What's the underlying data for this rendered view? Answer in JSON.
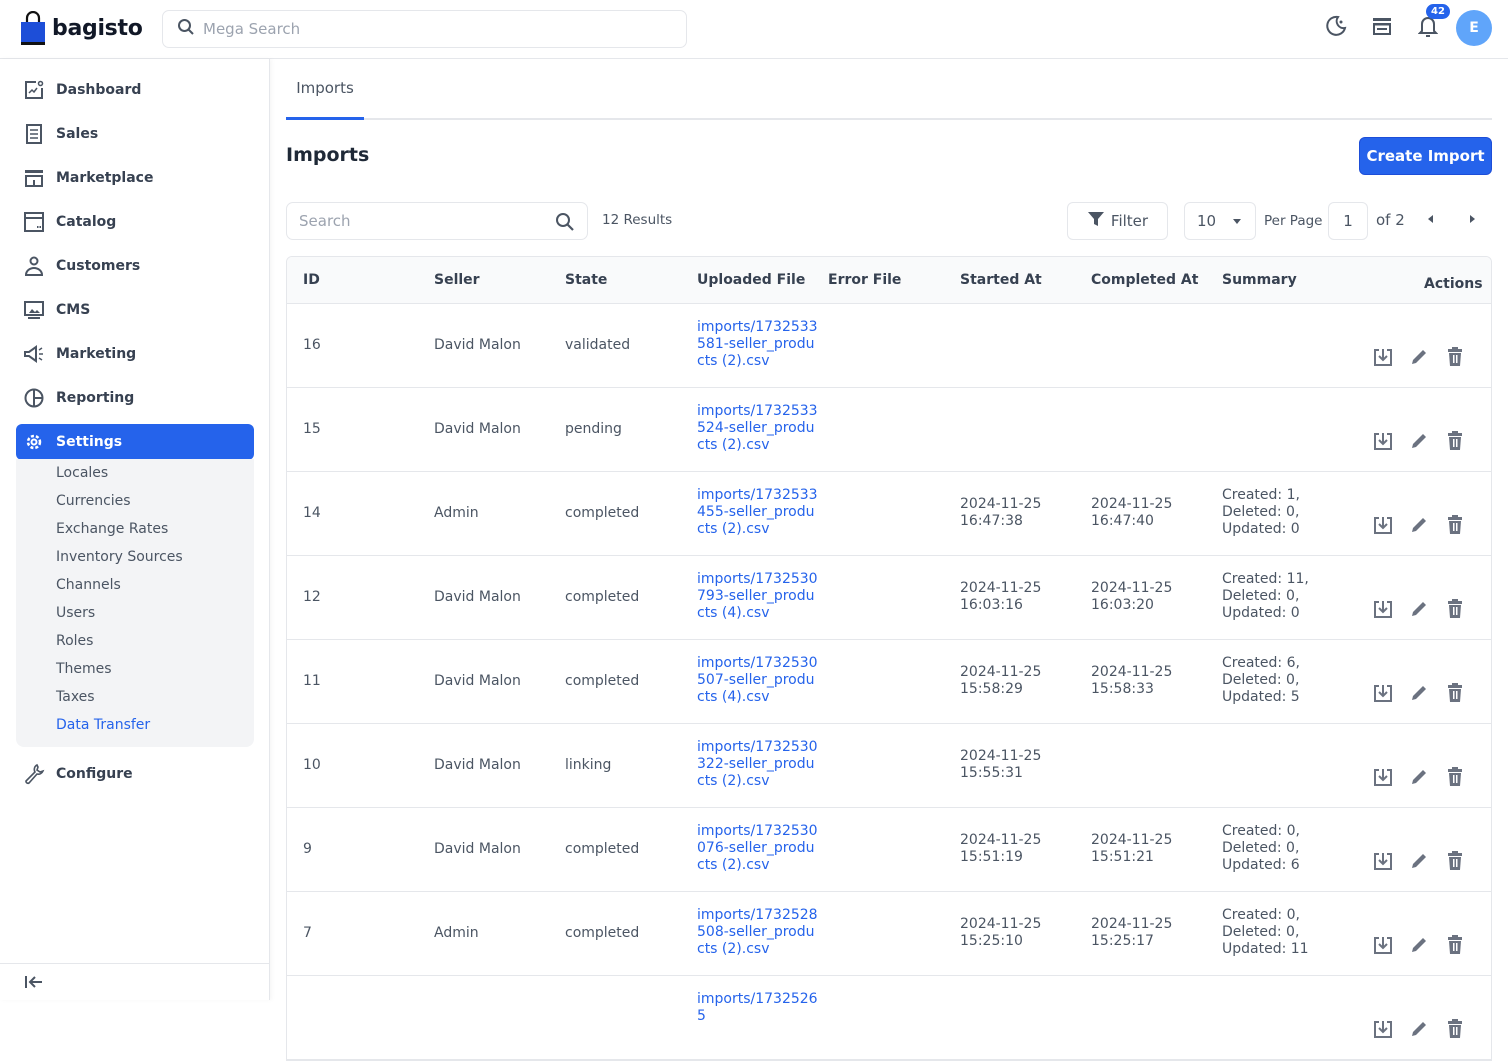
{
  "header": {
    "brand": "bagisto",
    "search_placeholder": "Mega Search",
    "notification_count": "42",
    "avatar_initial": "E",
    "icons": [
      "moon-icon",
      "store-icon",
      "bell-icon"
    ]
  },
  "sidebar": {
    "items": [
      {
        "label": "Dashboard",
        "icon": "dashboard-icon"
      },
      {
        "label": "Sales",
        "icon": "sales-icon"
      },
      {
        "label": "Marketplace",
        "icon": "marketplace-icon"
      },
      {
        "label": "Catalog",
        "icon": "catalog-icon"
      },
      {
        "label": "Customers",
        "icon": "customers-icon"
      },
      {
        "label": "CMS",
        "icon": "cms-icon"
      },
      {
        "label": "Marketing",
        "icon": "megaphone-icon"
      },
      {
        "label": "Reporting",
        "icon": "reporting-icon"
      },
      {
        "label": "Settings",
        "icon": "gear-icon",
        "active": true
      },
      {
        "label": "Configure",
        "icon": "wrench-icon"
      }
    ],
    "settings_children": [
      {
        "label": "Locales"
      },
      {
        "label": "Currencies"
      },
      {
        "label": "Exchange Rates"
      },
      {
        "label": "Inventory Sources"
      },
      {
        "label": "Channels"
      },
      {
        "label": "Users"
      },
      {
        "label": "Roles"
      },
      {
        "label": "Themes"
      },
      {
        "label": "Taxes"
      },
      {
        "label": "Data Transfer",
        "active": true
      }
    ]
  },
  "main": {
    "tab": "Imports",
    "title": "Imports",
    "create_button": "Create Import",
    "search_placeholder": "Search",
    "results": "12 Results",
    "filter_label": "Filter",
    "per_page_value": "10",
    "per_page_label": "Per Page",
    "current_page": "1",
    "page_of": "of 2",
    "columns": [
      "ID",
      "Seller",
      "State",
      "Uploaded File",
      "Error File",
      "Started At",
      "Completed At",
      "Summary",
      "Actions"
    ],
    "rows": [
      {
        "id": "16",
        "seller": "David Malon",
        "state": "validated",
        "file": "imports/1732533581-seller_products (2).csv",
        "error_file": "",
        "started_date": "",
        "started_time": "",
        "completed_date": "",
        "completed_time": "",
        "summary": [
          "",
          "",
          ""
        ]
      },
      {
        "id": "15",
        "seller": "David Malon",
        "state": "pending",
        "file": "imports/1732533524-seller_products (2).csv",
        "error_file": "",
        "started_date": "",
        "started_time": "",
        "completed_date": "",
        "completed_time": "",
        "summary": [
          "",
          "",
          ""
        ]
      },
      {
        "id": "14",
        "seller": "Admin",
        "state": "completed",
        "file": "imports/1732533455-seller_products (2).csv",
        "error_file": "",
        "started_date": "2024-11-25",
        "started_time": "16:47:38",
        "completed_date": "2024-11-25",
        "completed_time": "16:47:40",
        "summary": [
          "Created: 1,",
          "Deleted: 0,",
          "Updated: 0"
        ]
      },
      {
        "id": "12",
        "seller": "David Malon",
        "state": "completed",
        "file": "imports/1732530793-seller_products (4).csv",
        "error_file": "",
        "started_date": "2024-11-25",
        "started_time": "16:03:16",
        "completed_date": "2024-11-25",
        "completed_time": "16:03:20",
        "summary": [
          "Created: 11,",
          "Deleted: 0,",
          "Updated: 0"
        ]
      },
      {
        "id": "11",
        "seller": "David Malon",
        "state": "completed",
        "file": "imports/1732530507-seller_products (4).csv",
        "error_file": "",
        "started_date": "2024-11-25",
        "started_time": "15:58:29",
        "completed_date": "2024-11-25",
        "completed_time": "15:58:33",
        "summary": [
          "Created: 6,",
          "Deleted: 0,",
          "Updated: 5"
        ]
      },
      {
        "id": "10",
        "seller": "David Malon",
        "state": "linking",
        "file": "imports/1732530322-seller_products (2).csv",
        "error_file": "",
        "started_date": "2024-11-25",
        "started_time": "15:55:31",
        "completed_date": "",
        "completed_time": "",
        "summary": [
          "",
          "",
          ""
        ]
      },
      {
        "id": "9",
        "seller": "David Malon",
        "state": "completed",
        "file": "imports/1732530076-seller_products (2).csv",
        "error_file": "",
        "started_date": "2024-11-25",
        "started_time": "15:51:19",
        "completed_date": "2024-11-25",
        "completed_time": "15:51:21",
        "summary": [
          "Created: 0,",
          "Deleted: 0,",
          "Updated: 6"
        ]
      },
      {
        "id": "7",
        "seller": "Admin",
        "state": "completed",
        "file": "imports/1732528508-seller_products (2).csv",
        "error_file": "",
        "started_date": "2024-11-25",
        "started_time": "15:25:10",
        "completed_date": "2024-11-25",
        "completed_time": "15:25:17",
        "summary": [
          "Created: 0,",
          "Deleted: 0,",
          "Updated: 11"
        ]
      },
      {
        "id": "",
        "seller": "",
        "state": "",
        "file": "imports/17325265",
        "error_file": "",
        "started_date": "",
        "started_time": "",
        "completed_date": "",
        "completed_time": "",
        "summary": [
          "",
          "",
          ""
        ]
      }
    ]
  },
  "colors": {
    "accent": "#2563eb",
    "avatar": "#60a5fa",
    "text": "#374151",
    "border": "#e5e7eb"
  }
}
